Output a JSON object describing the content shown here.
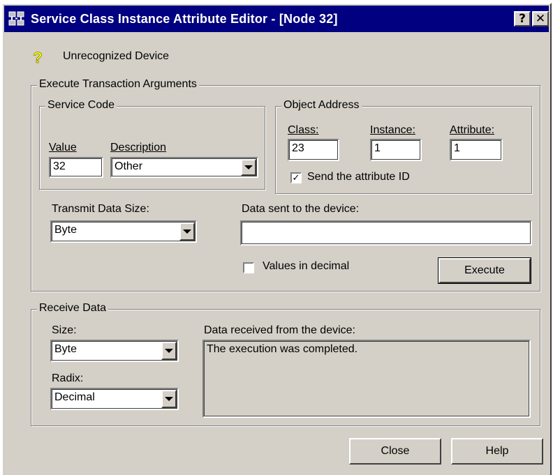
{
  "window": {
    "title": "Service Class Instance Attribute Editor - [Node 32]",
    "help_button": "?",
    "close_button": "✕"
  },
  "device": {
    "icon": "question-mark-icon",
    "label": "Unrecognized Device"
  },
  "execute": {
    "group_title": "Execute Transaction Arguments",
    "service_code": {
      "group_title": "Service Code",
      "value_label": "Value",
      "value": "32",
      "description_label": "Description",
      "description": "Other"
    },
    "object_address": {
      "group_title": "Object Address",
      "class_label": "Class:",
      "class_value": "23",
      "instance_label": "Instance:",
      "instance_value": "1",
      "attribute_label": "Attribute:",
      "attribute_value": "1",
      "send_attr_label": "Send the attribute ID",
      "send_attr_checked": true
    },
    "transmit_size_label": "Transmit Data Size:",
    "transmit_size": "Byte",
    "data_sent_label": "Data sent to the device:",
    "data_sent": "",
    "values_decimal_label": "Values in decimal",
    "values_decimal_checked": false,
    "execute_button": "Execute"
  },
  "receive": {
    "group_title": "Receive Data",
    "size_label": "Size:",
    "size": "Byte",
    "radix_label": "Radix:",
    "radix": "Decimal",
    "data_label": "Data received from the device:",
    "data": "The execution was completed."
  },
  "footer": {
    "close_button": "Close",
    "help_button": "Help"
  },
  "colors": {
    "title_bar": "#000080",
    "face": "#d4d0c8",
    "icon_question": "#ffff00"
  }
}
